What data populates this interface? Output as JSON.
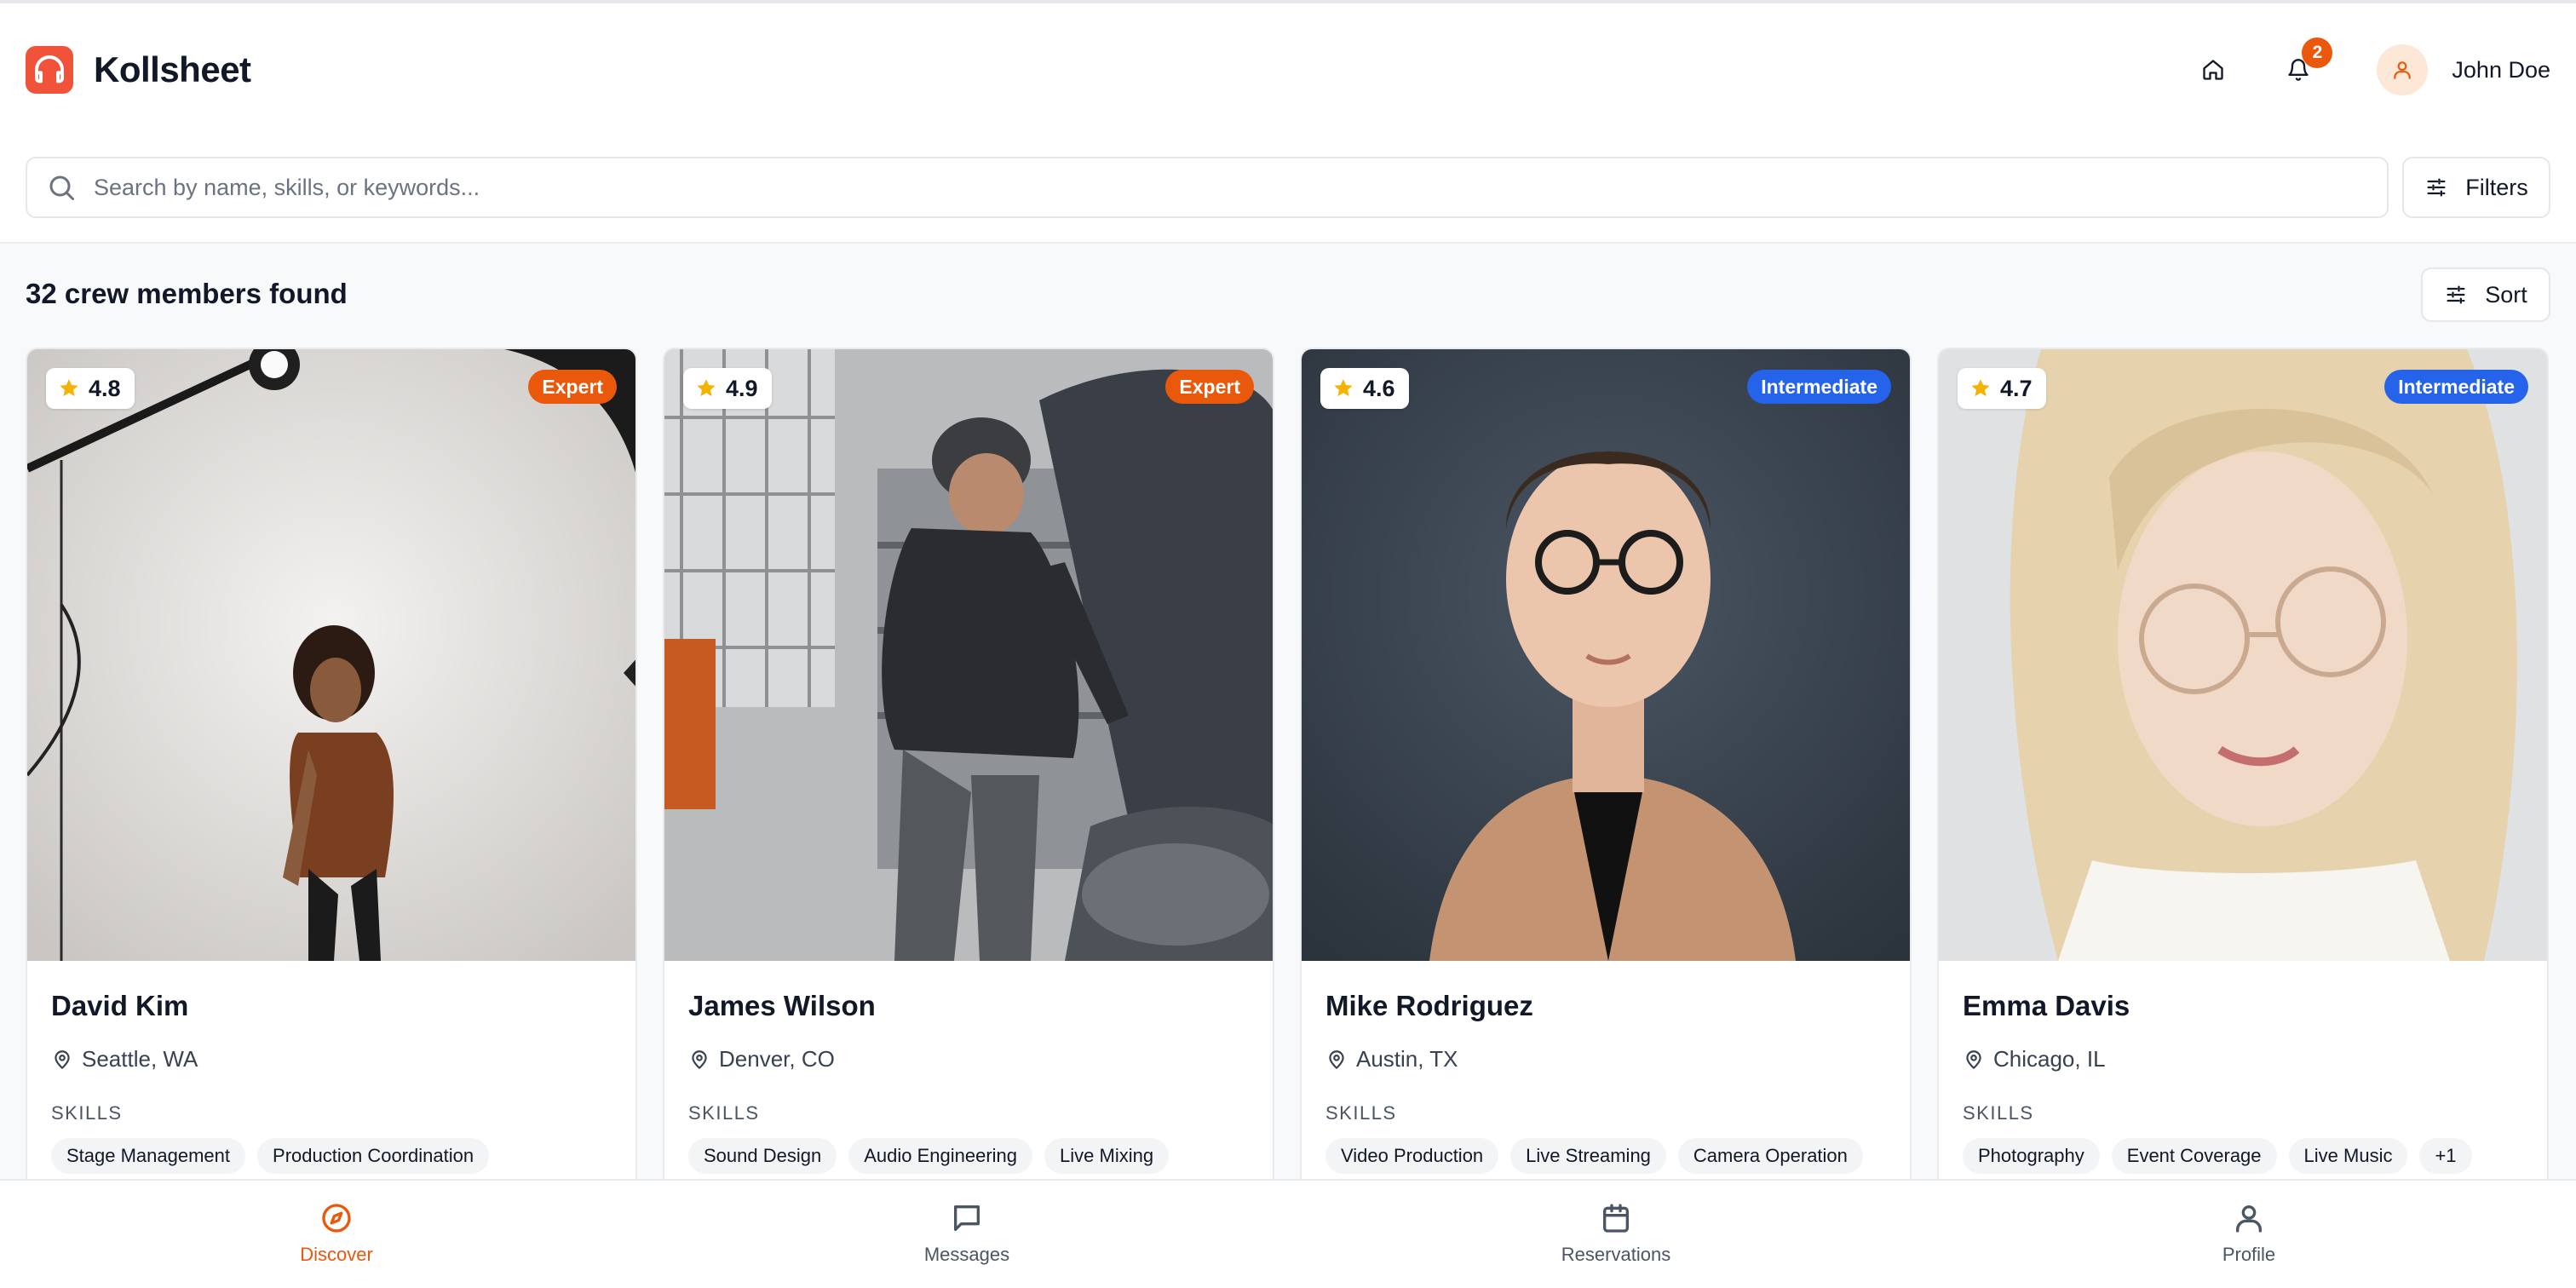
{
  "app": {
    "name": "Kollsheet",
    "brand_color": "#f0533a",
    "accent_color": "#ea580c"
  },
  "header": {
    "home_icon": "home-icon",
    "notifications": {
      "icon": "bell-icon",
      "count": "2"
    },
    "user": {
      "name": "John Doe",
      "avatar_icon": "user-icon"
    }
  },
  "search": {
    "placeholder": "Search by name, skills, or keywords...",
    "value": "",
    "filters_label": "Filters"
  },
  "results": {
    "count_text": "32 crew members found",
    "sort_label": "Sort"
  },
  "cards": [
    {
      "name": "David Kim",
      "rating": "4.8",
      "level": "Expert",
      "level_color": "#ea580c",
      "location": "Seattle, WA",
      "skills_label": "SKILLS",
      "skills": [
        "Stage Management",
        "Production Coordination"
      ]
    },
    {
      "name": "James Wilson",
      "rating": "4.9",
      "level": "Expert",
      "level_color": "#ea580c",
      "location": "Denver, CO",
      "skills_label": "SKILLS",
      "skills": [
        "Sound Design",
        "Audio Engineering",
        "Live Mixing"
      ]
    },
    {
      "name": "Mike Rodriguez",
      "rating": "4.6",
      "level": "Intermediate",
      "level_color": "#2563eb",
      "location": "Austin, TX",
      "skills_label": "SKILLS",
      "skills": [
        "Video Production",
        "Live Streaming",
        "Camera Operation"
      ]
    },
    {
      "name": "Emma Davis",
      "rating": "4.7",
      "level": "Intermediate",
      "level_color": "#2563eb",
      "location": "Chicago, IL",
      "skills_label": "SKILLS",
      "skills": [
        "Photography",
        "Event Coverage",
        "Live Music",
        "+1"
      ]
    }
  ],
  "bottom_nav": [
    {
      "label": "Discover",
      "icon": "compass-icon",
      "active": true
    },
    {
      "label": "Messages",
      "icon": "message-icon",
      "active": false
    },
    {
      "label": "Reservations",
      "icon": "calendar-icon",
      "active": false
    },
    {
      "label": "Profile",
      "icon": "user-icon",
      "active": false
    }
  ]
}
